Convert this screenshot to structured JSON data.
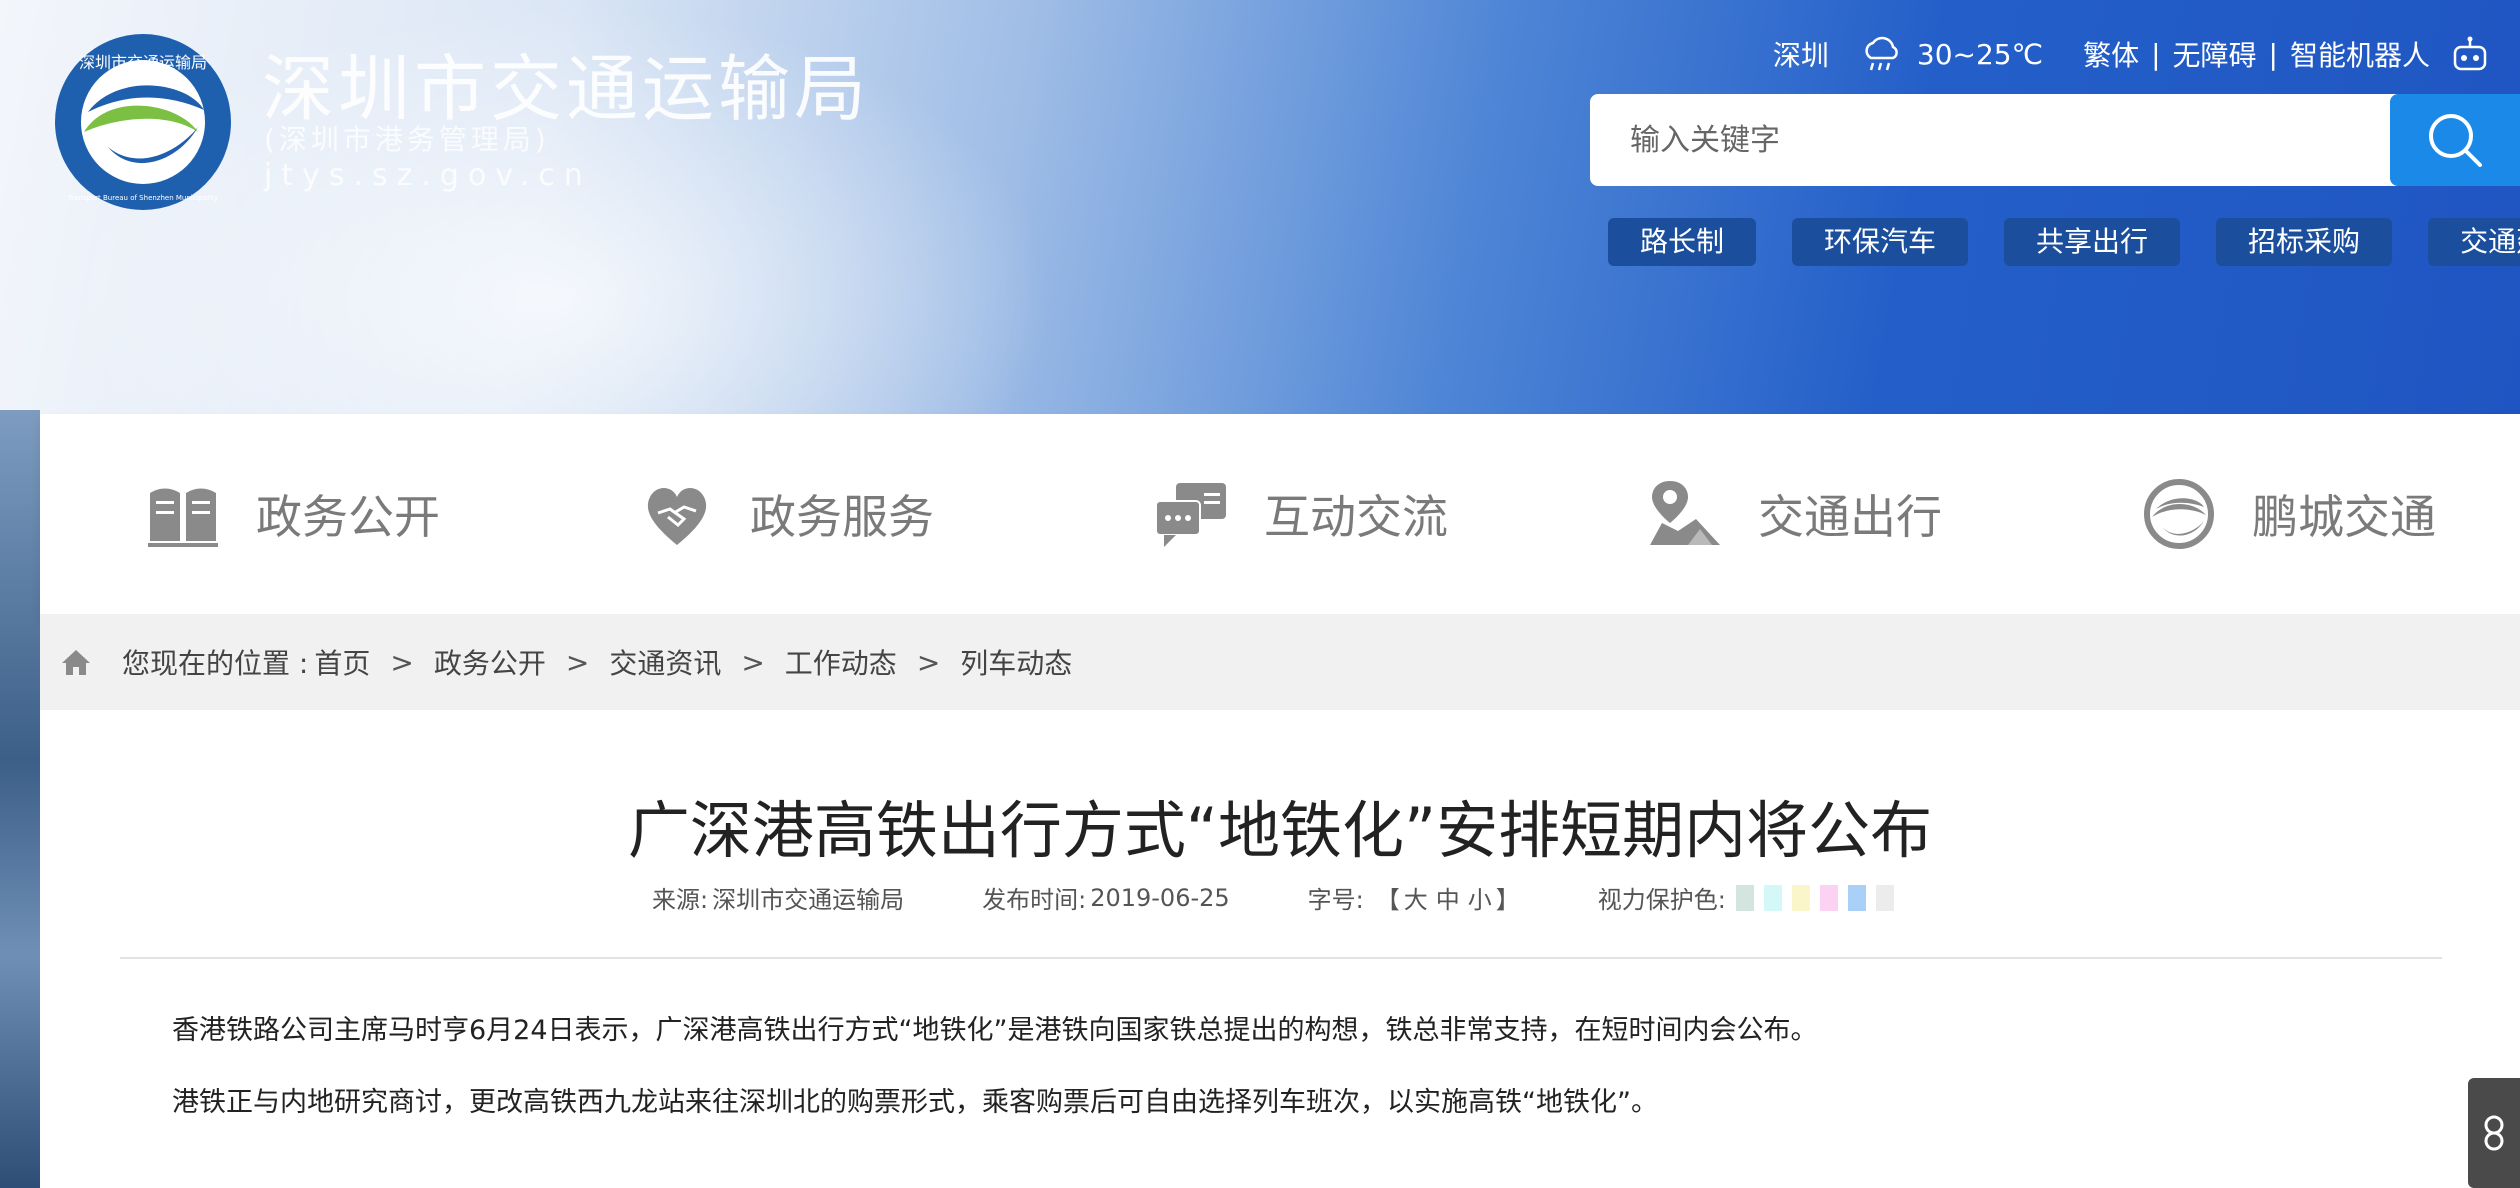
{
  "header": {
    "site_title": "深圳市交通运输局",
    "site_subtitle": "(深圳市港务管理局)",
    "site_domain": "jtys.sz.gov.cn",
    "logo_text": "深圳市交通运输局",
    "logo_ring_text": "Transport Bureau of Shenzhen Municipality",
    "city": "深圳",
    "weather_icon": "cloud-rain-icon",
    "temperature": "30~25℃",
    "links": [
      "繁体",
      "无障碍",
      "智能机器人"
    ],
    "separator": "|",
    "search_placeholder": "输入关键字",
    "quick_links": [
      "路长制",
      "环保汽车",
      "共享出行",
      "招标采购",
      "交通建设"
    ]
  },
  "nav": {
    "items": [
      {
        "label": "政务公开",
        "icon": "book-icon"
      },
      {
        "label": "政务服务",
        "icon": "handshake-heart-icon"
      },
      {
        "label": "互动交流",
        "icon": "chat-bubbles-icon"
      },
      {
        "label": "交通出行",
        "icon": "map-pin-icon"
      },
      {
        "label": "鹏城交通",
        "icon": "swirl-logo-icon"
      }
    ]
  },
  "breadcrumb": {
    "prefix": "您现在的位置 :",
    "items": [
      "首页",
      "政务公开",
      "交通资讯",
      "工作动态",
      "列车动态"
    ],
    "arrow": ">"
  },
  "article": {
    "title": "广深港高铁出行方式“地铁化”安排短期内将公布",
    "source_label": "来源:",
    "source": "深圳市交通运输局",
    "date_label": "发布时间:",
    "date": "2019-06-25",
    "fontsize_label": "字号:",
    "fontsize_open": "【",
    "fontsize_options": [
      "大",
      "中",
      "小"
    ],
    "fontsize_close": "】",
    "eye_color_label": "视力保护色:",
    "eye_colors": [
      "#d4e5e0",
      "#d4f7f7",
      "#fbf6c9",
      "#fbd2f2",
      "#a9d0f7",
      "#ececec"
    ],
    "paragraphs": [
      "香港铁路公司主席马时亨6月24日表示，广深港高铁出行方式“地铁化”是港铁向国家铁总提出的构想，铁总非常支持，在短时间内会公布。",
      "港铁正与内地研究商讨，更改高铁西九龙站来往深圳北的购票形式，乘客购票后可自由选择列车班次，以实施高铁“地铁化”。"
    ]
  }
}
